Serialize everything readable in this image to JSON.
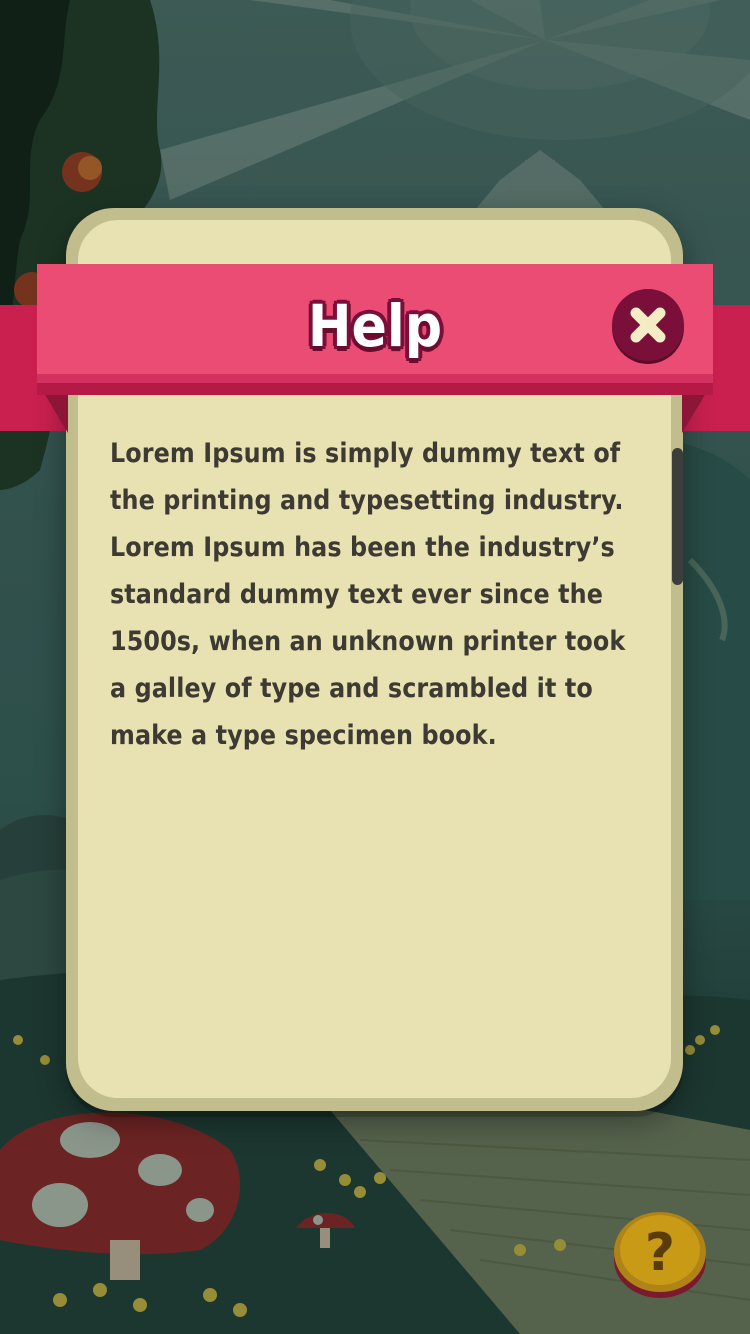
{
  "dialog": {
    "title": "Help",
    "body": "Lorem Ipsum is simply dummy text of the printing and typesetting industry. Lorem Ipsum has been the industry’s standard dummy text ever since the 1500s, when an unknown printer took a galley of type and scrambled it to make a type specimen book.",
    "close_icon": "close-x-icon"
  },
  "help_button": {
    "label": "?",
    "icon": "question-mark-coin-icon"
  },
  "colors": {
    "ribbon": "#ea4c74",
    "ribbon_dark": "#c9204f",
    "panel": "#e8e2b2",
    "panel_border": "#c2bd8c",
    "close_button": "#7a1039",
    "coin": "#c99a16",
    "text": "#3d3a33"
  }
}
